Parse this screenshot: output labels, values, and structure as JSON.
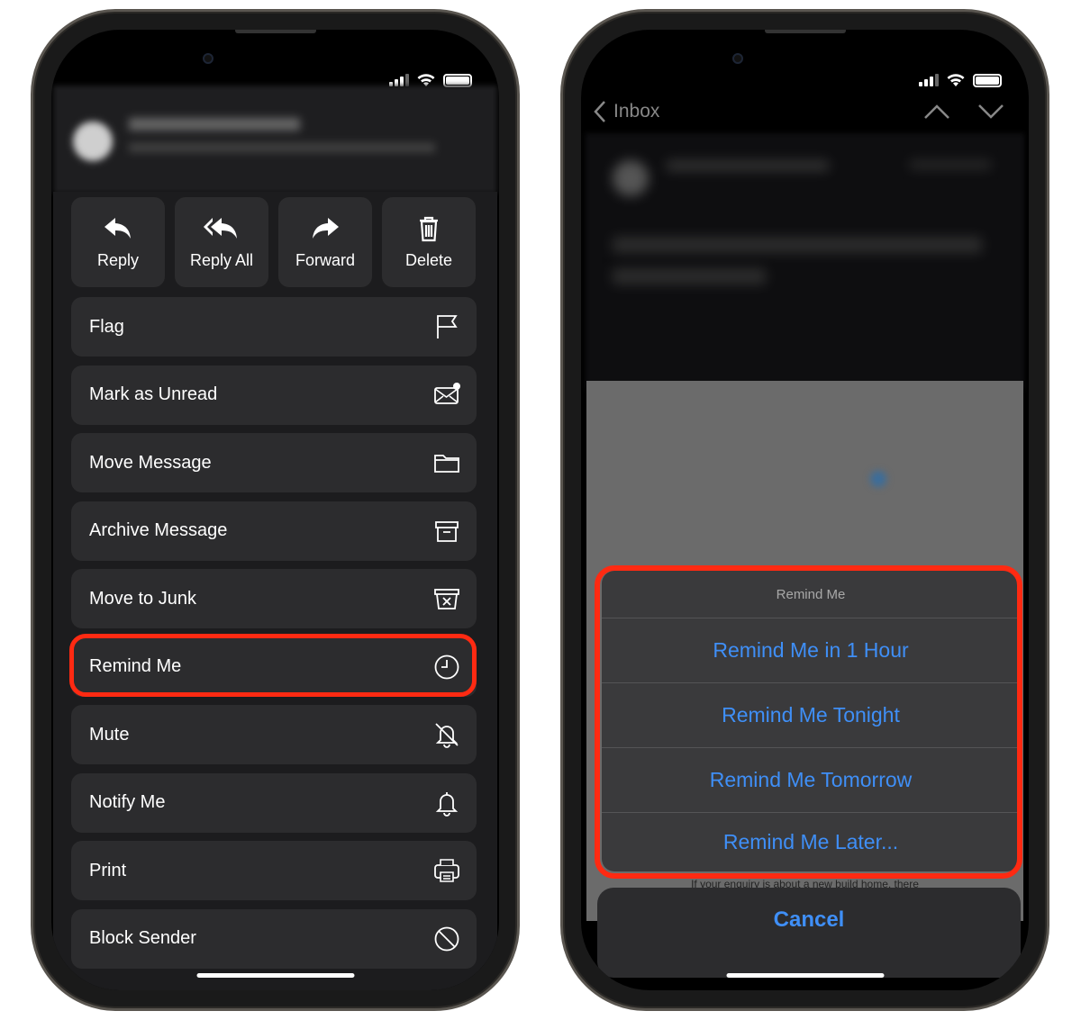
{
  "left_phone": {
    "actions": [
      {
        "label": "Reply",
        "icon": "reply-icon"
      },
      {
        "label": "Reply All",
        "icon": "reply-all-icon"
      },
      {
        "label": "Forward",
        "icon": "forward-icon"
      },
      {
        "label": "Delete",
        "icon": "trash-icon"
      }
    ],
    "menu_items": [
      {
        "label": "Flag",
        "icon": "flag-icon"
      },
      {
        "label": "Mark as Unread",
        "icon": "envelope-unread-icon"
      },
      {
        "label": "Move Message",
        "icon": "folder-icon"
      },
      {
        "label": "Archive Message",
        "icon": "archive-box-icon"
      },
      {
        "label": "Move to Junk",
        "icon": "junk-box-icon"
      },
      {
        "label": "Remind Me",
        "icon": "clock-icon",
        "highlighted": true
      },
      {
        "label": "Mute",
        "icon": "bell-slash-icon"
      },
      {
        "label": "Notify Me",
        "icon": "bell-icon"
      },
      {
        "label": "Print",
        "icon": "printer-icon"
      },
      {
        "label": "Block Sender",
        "icon": "block-icon"
      }
    ]
  },
  "right_phone": {
    "nav": {
      "back_label": "Inbox"
    },
    "sheet": {
      "title": "Remind Me",
      "options": [
        "Remind Me in 1 Hour",
        "Remind Me Tonight",
        "Remind Me Tomorrow",
        "Remind Me Later..."
      ],
      "cancel_label": "Cancel"
    },
    "peek_text": "If your enquiry is about a new build home, there"
  },
  "colors": {
    "highlight": "#ff2a12",
    "accent": "#3f8ff7",
    "cell": "#2c2c2e"
  }
}
